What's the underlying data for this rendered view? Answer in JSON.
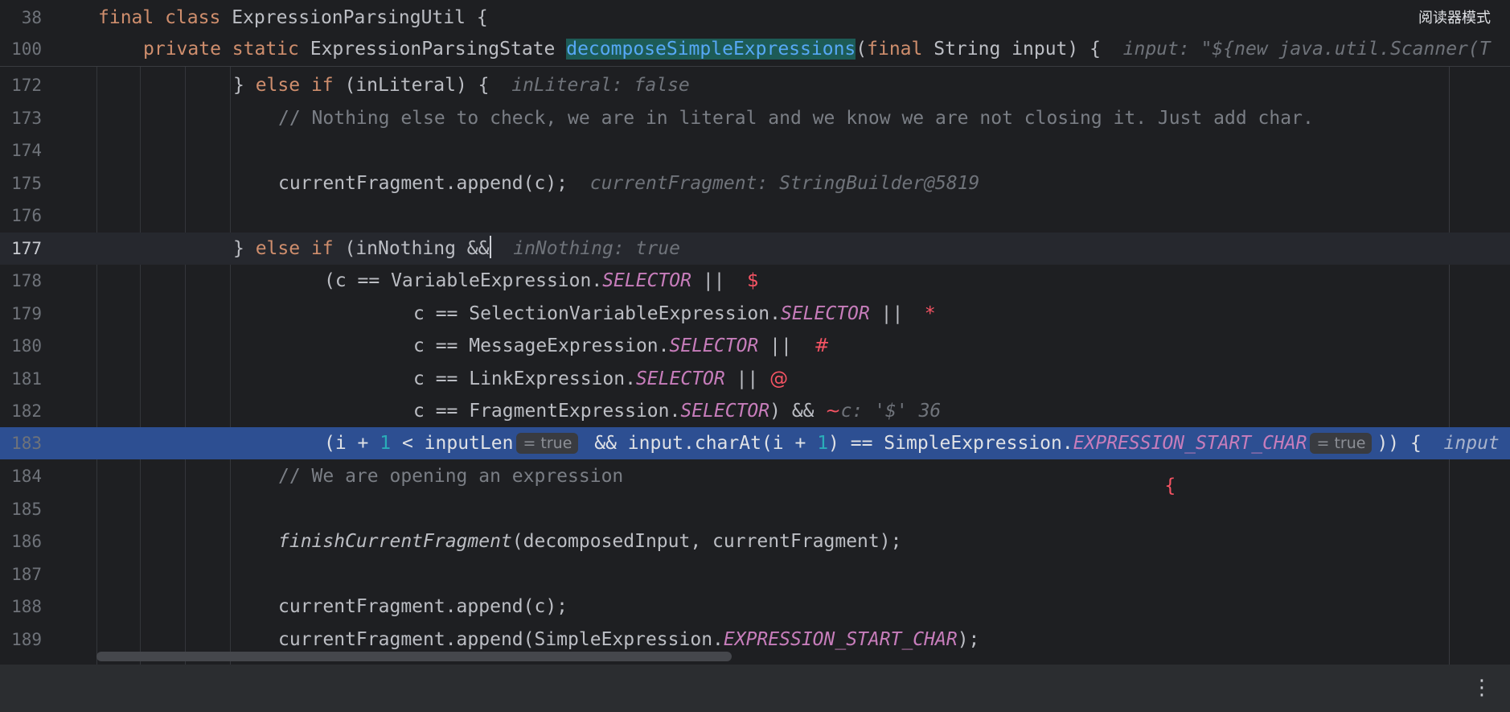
{
  "reader_mode": "阅读器模式",
  "sticky": {
    "l1": {
      "num": "38",
      "kw": "final class",
      "cls": "ExpressionParsingUtil {"
    },
    "l2": {
      "num": "100",
      "kw1": "private static",
      "type": "ExpressionParsingState",
      "fn": "decomposeSimpleExpressions",
      "p1": "(",
      "kw2": "final",
      "p2": " String input) {",
      "hint": "input: \"${new java.util.Scanner(T"
    }
  },
  "lines": {
    "l172": {
      "num": "172",
      "a": "} ",
      "kw": "else if",
      "b": " (inLiteral) {",
      "hint": "inLiteral: false"
    },
    "l173": {
      "num": "173",
      "cm": "// Nothing else to check, we are in literal and we know we are not closing it. Just add char."
    },
    "l174": {
      "num": "174"
    },
    "l175": {
      "num": "175",
      "a": "currentFragment.append(c);",
      "hint": "currentFragment: StringBuilder@5819"
    },
    "l176": {
      "num": "176"
    },
    "l177": {
      "num": "177",
      "a": "} ",
      "kw": "else if",
      "b": " (inNothing &&",
      "hint": "inNothing: true"
    },
    "l178": {
      "num": "178",
      "a": "(c == VariableExpression.",
      "s": "SELECTOR",
      "b": " ||",
      "sym": "$"
    },
    "l179": {
      "num": "179",
      "a": "c == SelectionVariableExpression.",
      "s": "SELECTOR",
      "b": " ||",
      "sym": "*"
    },
    "l180": {
      "num": "180",
      "a": "c == MessageExpression.",
      "s": "SELECTOR",
      "b": " ||",
      "sym": "#"
    },
    "l181": {
      "num": "181",
      "a": "c == LinkExpression.",
      "s": "SELECTOR",
      "b": " ||",
      "sym": "@"
    },
    "l182": {
      "num": "182",
      "a": "c == FragmentExpression.",
      "s": "SELECTOR",
      "b": ") &&",
      "sym": "~",
      "hint": "c: '$' 36"
    },
    "l183": {
      "num": "183",
      "a": "(i + ",
      "n1": "1",
      "b": " < inputLen",
      "chip1": "= true",
      "c": " && input.charAt(i + ",
      "n2": "1",
      "d": ") == SimpleExpression.",
      "s": "EXPRESSION_START_CHAR",
      "chip2": "= true",
      "e": ")) {",
      "hint": "input"
    },
    "l184": {
      "num": "184",
      "cm": "// We are opening an expression",
      "sym": "{"
    },
    "l185": {
      "num": "185"
    },
    "l186": {
      "num": "186",
      "fn": "finishCurrentFragment",
      "a": "(decomposedInput, currentFragment);"
    },
    "l187": {
      "num": "187"
    },
    "l188": {
      "num": "188",
      "a": "currentFragment.append(c);"
    },
    "l189": {
      "num": "189",
      "a": "currentFragment.append(SimpleExpression.",
      "s": "EXPRESSION_START_CHAR",
      "b": ");"
    }
  },
  "colors": {
    "background": "#1e1f22",
    "execution_line": "#2d4f92",
    "keyword": "#cf8e6d",
    "static_field": "#c77dbb",
    "number": "#2aacb8",
    "comment": "#7a7e85",
    "symbol": "#f75464"
  }
}
